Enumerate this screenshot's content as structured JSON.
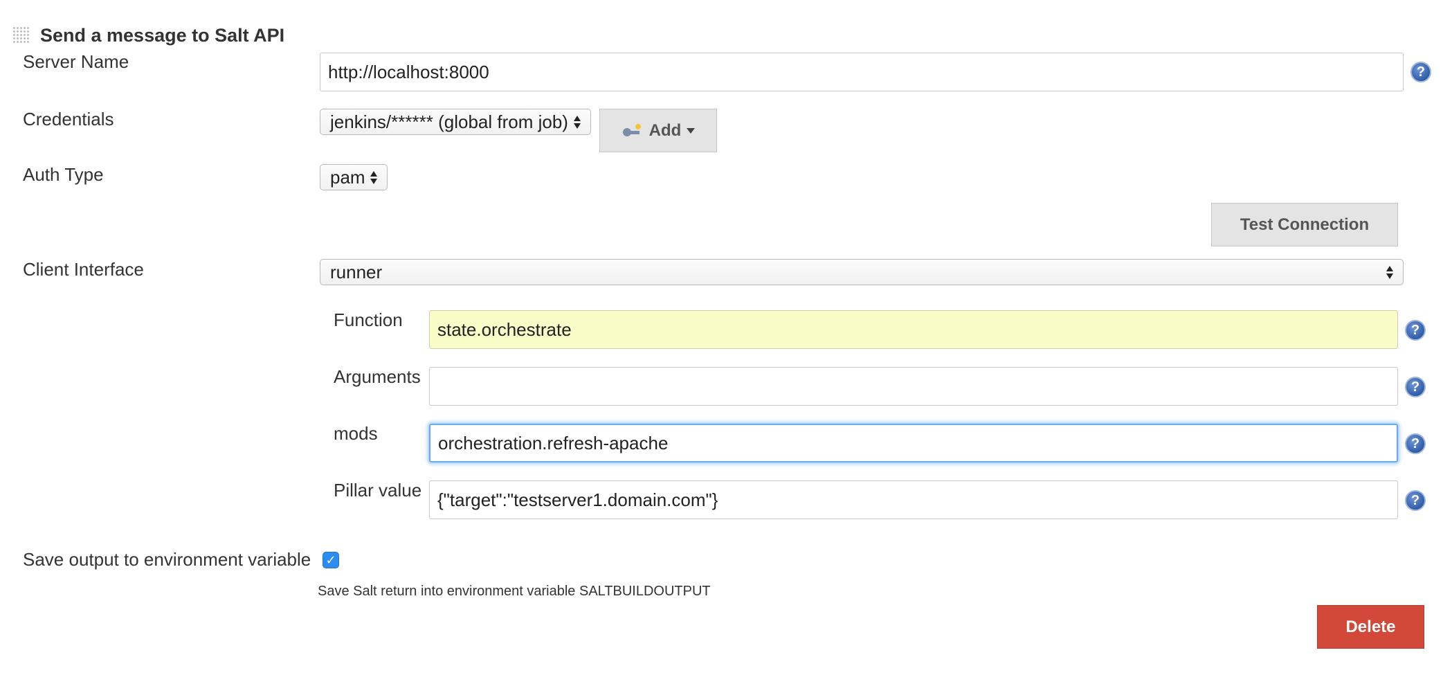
{
  "section": {
    "title": "Send a message to Salt API"
  },
  "server_name": {
    "label": "Server Name",
    "value": "http://localhost:8000"
  },
  "credentials": {
    "label": "Credentials",
    "selected": "jenkins/****** (global from job)",
    "add_label": "Add"
  },
  "auth_type": {
    "label": "Auth Type",
    "selected": "pam"
  },
  "test_connection_label": "Test Connection",
  "client_interface": {
    "label": "Client Interface",
    "selected": "runner"
  },
  "function": {
    "label": "Function",
    "value": "state.orchestrate"
  },
  "arguments": {
    "label": "Arguments",
    "value": ""
  },
  "mods": {
    "label": "mods",
    "value": "orchestration.refresh-apache"
  },
  "pillar": {
    "label": "Pillar value",
    "value": "{\"target\":\"testserver1.domain.com\"}"
  },
  "save_output": {
    "label": "Save output to environment variable",
    "checked": true,
    "description": "Save Salt return into environment variable SALTBUILDOUTPUT"
  },
  "delete_label": "Delete",
  "help_glyph": "?",
  "icons": {
    "help": "question-circle-icon",
    "add": "key-add-icon",
    "drag": "drag-handle-icon",
    "checkbox": "checkmark-icon"
  },
  "colors": {
    "delete_button": "#d24939",
    "highlight_field": "#fafcc8",
    "focus_ring": "#6aa9f0",
    "checkbox": "#2d8cf0",
    "help_icon": "#2f5ea8"
  }
}
